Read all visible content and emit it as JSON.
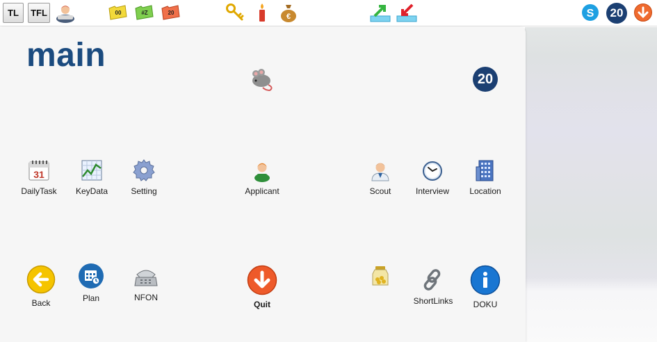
{
  "toolbar": {
    "tl_label": "TL",
    "tfl_label": "TFL",
    "folders": [
      "00",
      "#Z",
      "20"
    ],
    "badge_number": "20",
    "icons": [
      "users-icon",
      "key-icon",
      "candle-icon",
      "money-bag-icon",
      "export-icon",
      "import-icon",
      "skype-icon",
      "down-arrow-icon"
    ]
  },
  "main": {
    "title": "main",
    "badge_number": "20",
    "items": [
      {
        "label": "DailyTask",
        "icon": "calendar-icon"
      },
      {
        "label": "KeyData",
        "icon": "chart-icon"
      },
      {
        "label": "Setting",
        "icon": "gear-icon"
      },
      {
        "label": "Applicant",
        "icon": "person-icon"
      },
      {
        "label": "Scout",
        "icon": "doctor-icon"
      },
      {
        "label": "Interview",
        "icon": "clock-icon"
      },
      {
        "label": "Location",
        "icon": "building-icon"
      },
      {
        "label": "Back",
        "icon": "back-arrow-icon"
      },
      {
        "label": "Plan",
        "icon": "planner-icon"
      },
      {
        "label": "NFON",
        "icon": "phone-icon"
      },
      {
        "label": "Quit",
        "icon": "quit-icon"
      },
      {
        "label": "ShortLinks",
        "icon": "chain-icon"
      },
      {
        "label": "DOKU",
        "icon": "info-icon"
      }
    ]
  },
  "colors": {
    "title": "#1b4b7f",
    "badge": "#1b3f72",
    "panel": "#f6f6f6"
  }
}
